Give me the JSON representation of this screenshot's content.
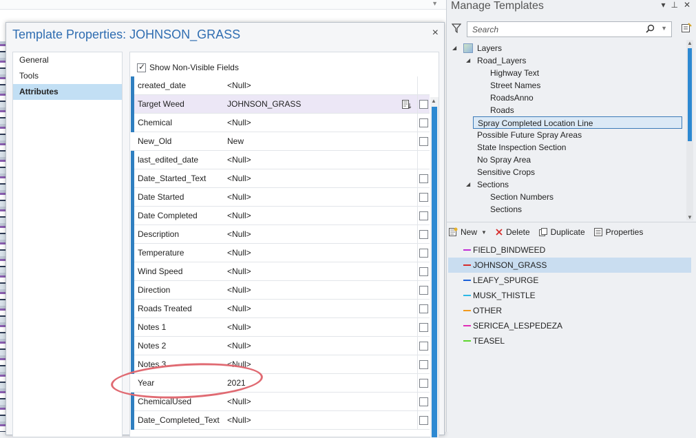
{
  "dialog": {
    "title": "Template Properties: JOHNSON_GRASS",
    "close": "×",
    "nav": [
      {
        "label": "General",
        "active": false
      },
      {
        "label": "Tools",
        "active": false
      },
      {
        "label": "Attributes",
        "active": true
      }
    ],
    "show_nonvisible_label": "Show Non-Visible Fields",
    "show_nonvisible_checked": true,
    "rows": [
      {
        "name": "created_date",
        "value": "<Null>",
        "bar": true,
        "checkbox": false,
        "selected": false
      },
      {
        "name": "Target Weed",
        "value": "JOHNSON_GRASS",
        "bar": true,
        "checkbox": true,
        "selected": true
      },
      {
        "name": "Chemical",
        "value": "<Null>",
        "bar": true,
        "checkbox": true,
        "selected": false
      },
      {
        "name": "New_Old",
        "value": "New",
        "bar": false,
        "checkbox": true,
        "selected": false
      },
      {
        "name": "last_edited_date",
        "value": "<Null>",
        "bar": true,
        "checkbox": false,
        "selected": false
      },
      {
        "name": "Date_Started_Text",
        "value": "<Null>",
        "bar": true,
        "checkbox": true,
        "selected": false
      },
      {
        "name": "Date Started",
        "value": "<Null>",
        "bar": true,
        "checkbox": true,
        "selected": false
      },
      {
        "name": "Date Completed",
        "value": "<Null>",
        "bar": true,
        "checkbox": true,
        "selected": false
      },
      {
        "name": "Description",
        "value": "<Null>",
        "bar": true,
        "checkbox": true,
        "selected": false
      },
      {
        "name": "Temperature",
        "value": "<Null>",
        "bar": true,
        "checkbox": true,
        "selected": false
      },
      {
        "name": "Wind Speed",
        "value": "<Null>",
        "bar": true,
        "checkbox": true,
        "selected": false
      },
      {
        "name": "Direction",
        "value": "<Null>",
        "bar": true,
        "checkbox": true,
        "selected": false
      },
      {
        "name": "Roads Treated",
        "value": "<Null>",
        "bar": true,
        "checkbox": true,
        "selected": false
      },
      {
        "name": "Notes 1",
        "value": "<Null>",
        "bar": true,
        "checkbox": true,
        "selected": false
      },
      {
        "name": "Notes 2",
        "value": "<Null>",
        "bar": true,
        "checkbox": true,
        "selected": false
      },
      {
        "name": "Notes 3",
        "value": "<Null>",
        "bar": true,
        "checkbox": true,
        "selected": false
      },
      {
        "name": "Year",
        "value": "2021",
        "bar": false,
        "checkbox": true,
        "selected": false
      },
      {
        "name": "ChemicalUsed",
        "value": "<Null>",
        "bar": true,
        "checkbox": true,
        "selected": false
      },
      {
        "name": "Date_Completed_Text",
        "value": "<Null>",
        "bar": true,
        "checkbox": true,
        "selected": false
      }
    ]
  },
  "pane": {
    "title": "Manage Templates",
    "search_placeholder": "Search",
    "tree": [
      {
        "label": "Layers",
        "level": 0,
        "expanded": true,
        "icon": "layers-icon"
      },
      {
        "label": "Road_Layers",
        "level": 1,
        "expanded": true
      },
      {
        "label": "Highway Text",
        "level": 2
      },
      {
        "label": "Street Names",
        "level": 2
      },
      {
        "label": "RoadsAnno",
        "level": 2
      },
      {
        "label": "Roads",
        "level": 2
      },
      {
        "label": "Spray Completed Location Line",
        "level": 1,
        "selected": true
      },
      {
        "label": "Possible Future Spray Areas",
        "level": 1
      },
      {
        "label": "State Inspection Section",
        "level": 1
      },
      {
        "label": "No Spray Area",
        "level": 1
      },
      {
        "label": "Sensitive Crops",
        "level": 1
      },
      {
        "label": "Sections",
        "level": 1,
        "expanded": true
      },
      {
        "label": "Section Numbers",
        "level": 2
      },
      {
        "label": "Sections",
        "level": 2
      }
    ],
    "toolbar": {
      "new": "New",
      "delete": "Delete",
      "duplicate": "Duplicate",
      "properties": "Properties"
    },
    "templates": [
      {
        "label": "FIELD_BINDWEED",
        "color": "#c02cd6",
        "selected": false
      },
      {
        "label": "JOHNSON_GRASS",
        "color": "#d62a2a",
        "selected": true
      },
      {
        "label": "LEAFY_SPURGE",
        "color": "#1a5fd8",
        "selected": false
      },
      {
        "label": "MUSK_THISTLE",
        "color": "#2cb8e6",
        "selected": false
      },
      {
        "label": "OTHER",
        "color": "#f29a1c",
        "selected": false
      },
      {
        "label": "SERICEA_LESPEDEZA",
        "color": "#e02cb6",
        "selected": false
      },
      {
        "label": "TEASEL",
        "color": "#5cd62c",
        "selected": false
      }
    ]
  },
  "colors": {
    "accent": "#2f7fc0",
    "title": "#2f6db1",
    "annotation": "#e06a72"
  }
}
